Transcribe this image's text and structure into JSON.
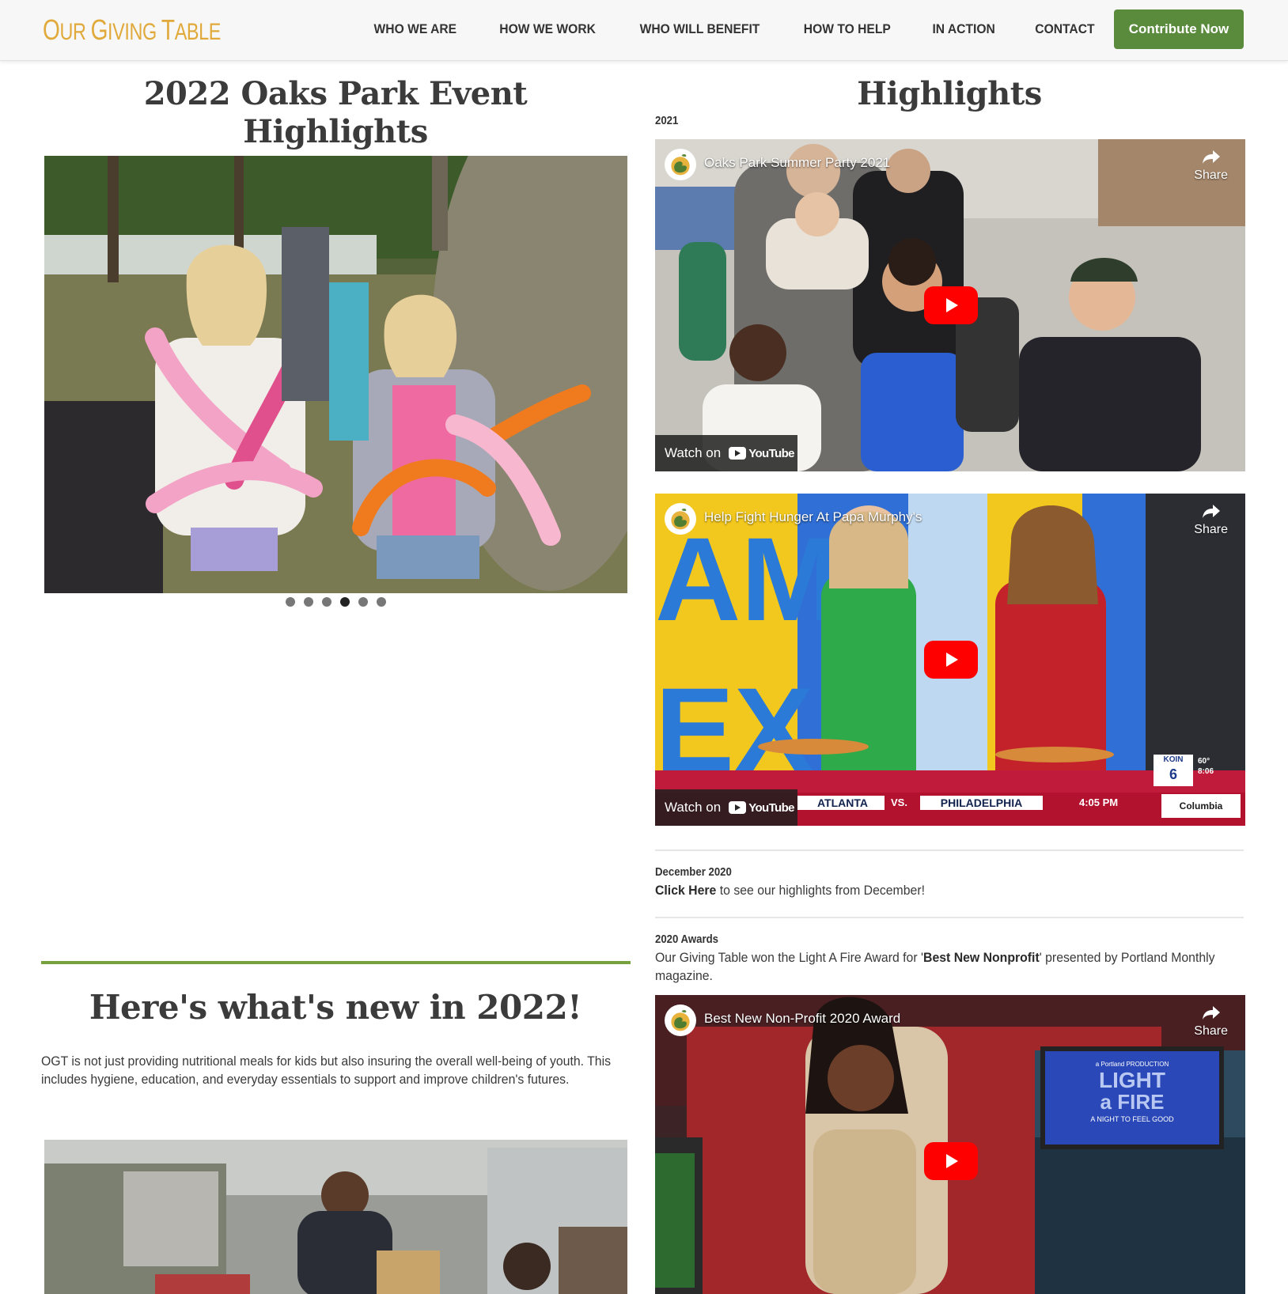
{
  "header": {
    "logo_text_parts": [
      "O",
      "UR ",
      "G",
      "IVING ",
      "T",
      "ABLE"
    ],
    "nav": [
      "WHO WE ARE",
      "HOW WE WORK",
      "WHO WILL BENEFIT",
      "HOW TO HELP",
      "IN ACTION",
      "CONTACT"
    ],
    "cta_label": "Contribute Now"
  },
  "colors": {
    "brand_green": "#5a8a3c",
    "brand_gold": "#e0a93a",
    "rule_green": "#76a23e",
    "youtube_red": "#ff0000"
  },
  "left": {
    "title_line1": "2022 Oaks Park Event",
    "title_line2": "Highlights",
    "carousel": {
      "slide_count": 6,
      "active_index": 3
    },
    "new_section_title": "Here's what's new in 2022!",
    "new_section_text": "OGT is not just providing nutritional meals for kids but also insuring the overall well-being of youth. This includes hygiene, education, and everyday essentials to support and improve children's futures."
  },
  "right": {
    "title": "Highlights",
    "year_label": "2021",
    "videos": [
      {
        "title": "Oaks Park Summer Party 2021",
        "share": "Share",
        "watch_on": "Watch on",
        "youtube": "YouTube"
      },
      {
        "title": "Help Fight Hunger At Papa Murphy's",
        "share": "Share",
        "watch_on": "Watch on",
        "youtube": "YouTube",
        "ticker_left": "ATLANTA",
        "ticker_vs": "VS.",
        "ticker_right": "PHILADELPHIA",
        "ticker_time": "4:05 PM",
        "station": "KOIN",
        "station_num": "6",
        "temp": "60°",
        "clock": "8:06",
        "sponsor": "Columbia"
      },
      {
        "title": "Best New Non-Profit 2020 Award",
        "share": "Share",
        "screen_brand": "a Portland PRODUCTION",
        "screen_title_1": "LIGHT",
        "screen_title_2": "a FIRE",
        "screen_sub": "A NIGHT TO FEEL GOOD"
      }
    ],
    "december": {
      "label": "December 2020",
      "link": "Click Here",
      "rest": " to see our highlights from December!"
    },
    "awards": {
      "label": "2020 Awards",
      "text_before": "Our Giving Table won the Light A Fire Award for '",
      "bold": "Best New Nonprofit",
      "text_after": "' presented by Portland Monthly magazine."
    }
  }
}
